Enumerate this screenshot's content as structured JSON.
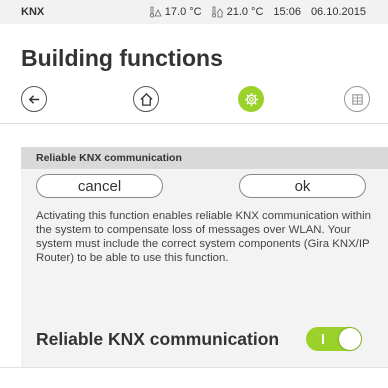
{
  "statusbar": {
    "app_name": "KNX",
    "temp_outside": "17.0 °C",
    "temp_inside": "21.0 °C",
    "time": "15:06",
    "date": "06.10.2015"
  },
  "page_title": "Building functions",
  "navbar": {
    "back_icon": "arrow-left-icon",
    "home_icon": "home-icon",
    "settings_icon": "gear-icon",
    "grid_icon": "grid-icon",
    "accent_color": "#9ad12b"
  },
  "panel": {
    "header": "Reliable KNX communication",
    "cancel_label": "cancel",
    "ok_label": "ok",
    "description": "Activating this function enables reliable KNX communication within the system to compensate loss of messages over WLAN. Your system must include the correct system components (Gira KNX/IP Router) to be able to use this function."
  },
  "toggle_row": {
    "label": "Reliable KNX communication",
    "state": "on"
  }
}
